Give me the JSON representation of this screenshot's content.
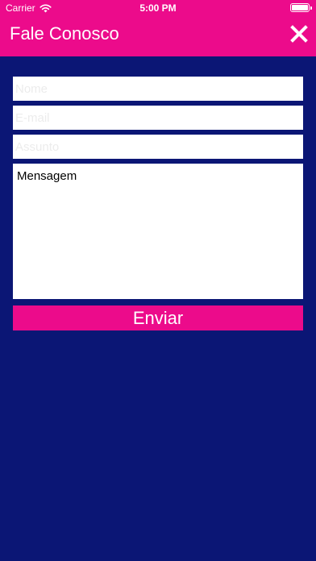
{
  "status_bar": {
    "carrier": "Carrier",
    "time": "5:00 PM",
    "battery_level": 1.0
  },
  "header": {
    "title": "Fale Conosco"
  },
  "form": {
    "name_placeholder": "Nome",
    "email_placeholder": "E-mail",
    "subject_placeholder": "Assunto",
    "message_text": "Mensagem",
    "submit_label": "Enviar"
  },
  "colors": {
    "brand_pink": "#ec0b8b",
    "background_navy": "#0b1675"
  }
}
